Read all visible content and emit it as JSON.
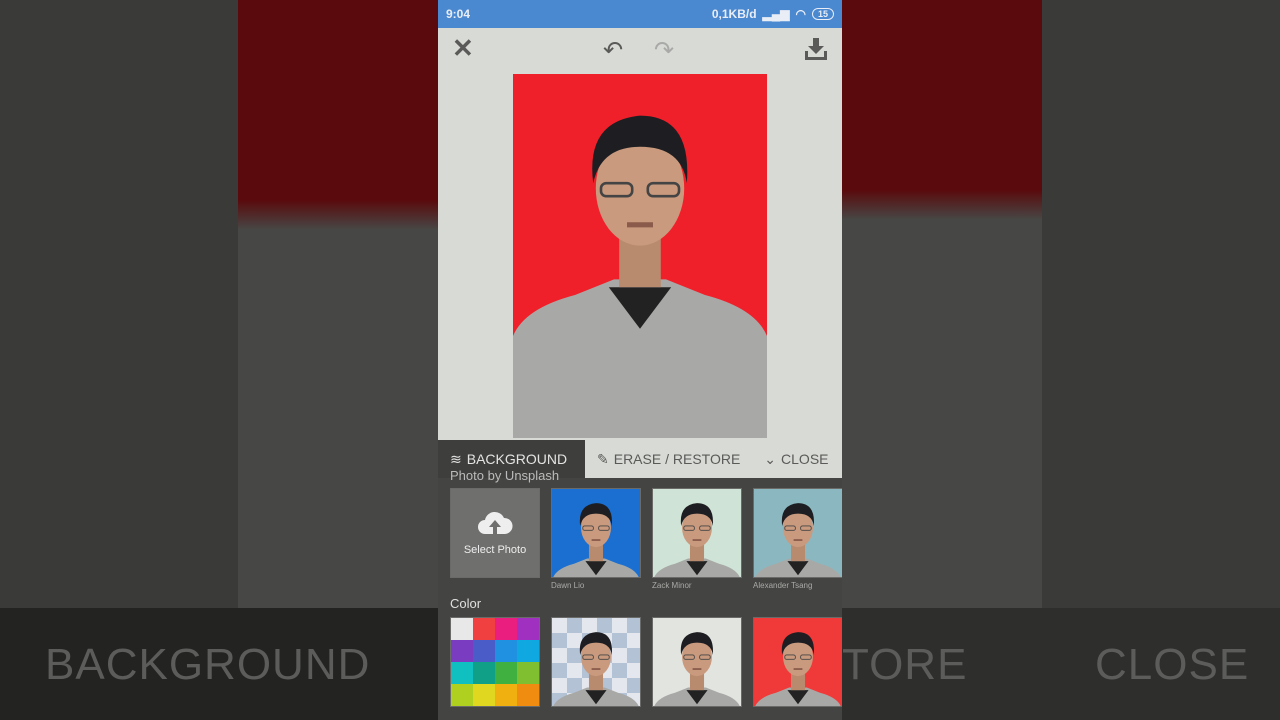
{
  "status_bar": {
    "time": "9:04",
    "network": "0,1KB/d",
    "battery": "15"
  },
  "toolbar": {
    "close_icon": "close-icon",
    "undo_icon": "undo-icon",
    "redo_icon": "redo-icon",
    "download_icon": "download-icon"
  },
  "photo": {
    "background_color": "#f0202a"
  },
  "tabs": [
    {
      "label": "BACKGROUND",
      "icon": "layers-icon",
      "active": true
    },
    {
      "label": "ERASE / RESTORE",
      "icon": "pencil-icon"
    },
    {
      "label": "CLOSE",
      "icon": "chevron-down-icon"
    }
  ],
  "panel": {
    "photo_section_label": "Photo by Unsplash",
    "select_photo": "Select Photo",
    "photos": [
      {
        "caption": "Dawn Lio",
        "bg": "#1a6fd0"
      },
      {
        "caption": "Zack Minor",
        "bg": "#cfe3d6"
      },
      {
        "caption": "Alexander Tsang",
        "bg": "#8bb8c0"
      }
    ],
    "color_label": "Color",
    "palette": [
      "#e8e8e8",
      "#f04040",
      "#e91e7e",
      "#a030c0",
      "#7a3cc0",
      "#4a5cc8",
      "#2090e0",
      "#10a8e0",
      "#10c0c0",
      "#10a088",
      "#40b040",
      "#80c030",
      "#b0d020",
      "#e0d820",
      "#f0b010",
      "#f08c10"
    ],
    "color_options": [
      {
        "type": "transparent"
      },
      {
        "type": "solid",
        "bg": "#e2e4e0"
      },
      {
        "type": "solid",
        "bg": "#f03a3a"
      }
    ]
  },
  "background_overlay": {
    "left": "BACKGROUND",
    "middle": "TORE",
    "right": "CLOSE"
  }
}
